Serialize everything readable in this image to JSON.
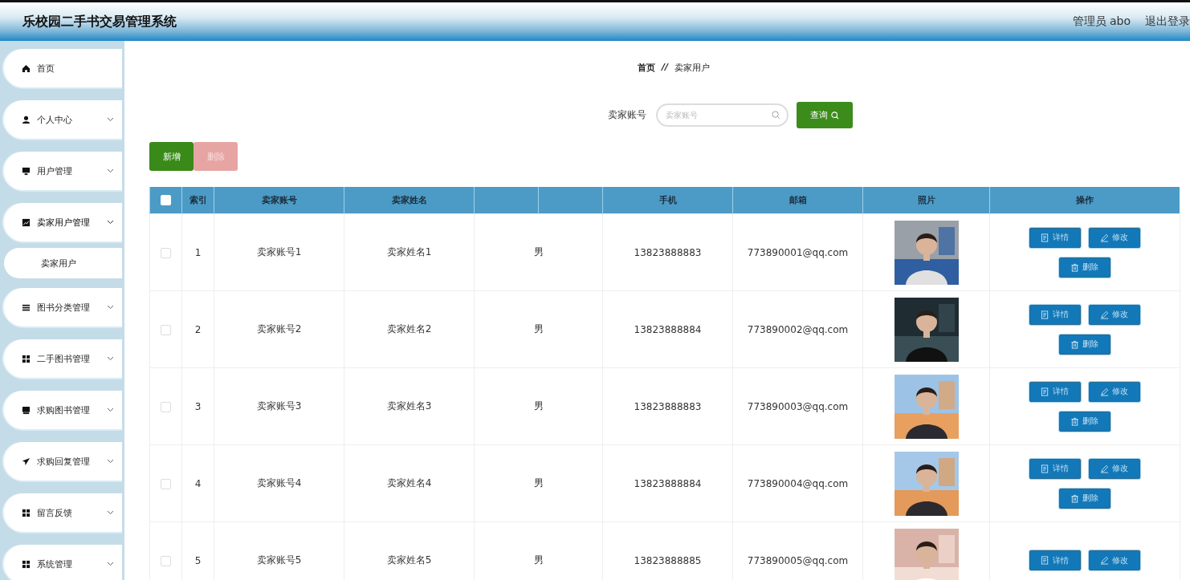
{
  "header": {
    "title": "乐校园二手书交易管理系统",
    "user": "管理员 abo",
    "logout": "退出登录"
  },
  "sidebar": {
    "items": [
      {
        "label": "首页",
        "kind": "link"
      },
      {
        "label": "个人中心",
        "kind": "menu",
        "expanded": false
      },
      {
        "label": "用户管理",
        "kind": "menu",
        "expanded": false
      },
      {
        "label": "卖家用户管理",
        "kind": "menu",
        "expanded": true,
        "children": [
          {
            "label": "卖家用户",
            "selected": true
          }
        ]
      },
      {
        "label": "图书分类管理",
        "kind": "menu",
        "expanded": false
      },
      {
        "label": "二手图书管理",
        "kind": "menu",
        "expanded": false
      },
      {
        "label": "求购图书管理",
        "kind": "menu",
        "expanded": false
      },
      {
        "label": "求购回复管理",
        "kind": "menu",
        "expanded": false
      },
      {
        "label": "留言反馈",
        "kind": "menu",
        "expanded": false
      },
      {
        "label": "系统管理",
        "kind": "menu",
        "expanded": false
      }
    ]
  },
  "breadcrumb": [
    "首页",
    "卖家用户"
  ],
  "breadcrumb_separator": "//",
  "search": {
    "label": "卖家账号",
    "placeholder": "卖家账号",
    "button": "查询"
  },
  "toolbar": [
    {
      "label": "新增",
      "kind": "add",
      "disabled": false
    },
    {
      "label": "删除",
      "kind": "delete",
      "disabled": true
    }
  ],
  "table": {
    "select_all": {
      "checked": false
    },
    "columns": [
      "索引",
      "卖家账号",
      "卖家姓名",
      "",
      "",
      "手机",
      "邮箱",
      "照片",
      "操作"
    ],
    "rows": [
      {
        "checked": false,
        "index": "1",
        "account": "卖家账号1",
        "name": "卖家姓名1",
        "gender": "男",
        "phone": "13823888883",
        "email": "773890001@qq.com",
        "actions": [
          {
            "label": "详情",
            "kind": "detail"
          },
          {
            "label": "修改",
            "kind": "edit"
          },
          {
            "label": "删除",
            "kind": "delete"
          }
        ]
      },
      {
        "checked": false,
        "index": "2",
        "account": "卖家账号2",
        "name": "卖家姓名2",
        "gender": "男",
        "phone": "13823888884",
        "email": "773890002@qq.com",
        "actions": [
          {
            "label": "详情",
            "kind": "detail"
          },
          {
            "label": "修改",
            "kind": "edit"
          },
          {
            "label": "删除",
            "kind": "delete"
          }
        ]
      },
      {
        "checked": false,
        "index": "3",
        "account": "卖家账号3",
        "name": "卖家姓名3",
        "gender": "男",
        "phone": "13823888883",
        "email": "773890003@qq.com",
        "actions": [
          {
            "label": "详情",
            "kind": "detail"
          },
          {
            "label": "修改",
            "kind": "edit"
          },
          {
            "label": "删除",
            "kind": "delete"
          }
        ]
      },
      {
        "checked": false,
        "index": "4",
        "account": "卖家账号4",
        "name": "卖家姓名4",
        "gender": "男",
        "phone": "13823888884",
        "email": "773890004@qq.com",
        "actions": [
          {
            "label": "详情",
            "kind": "detail"
          },
          {
            "label": "修改",
            "kind": "edit"
          },
          {
            "label": "删除",
            "kind": "delete"
          }
        ]
      },
      {
        "checked": false,
        "index": "5",
        "account": "卖家账号5",
        "name": "卖家姓名5",
        "gender": "男",
        "phone": "13823888885",
        "email": "773890005@qq.com",
        "actions": [
          {
            "label": "详情",
            "kind": "detail"
          },
          {
            "label": "修改",
            "kind": "edit"
          }
        ]
      }
    ]
  }
}
